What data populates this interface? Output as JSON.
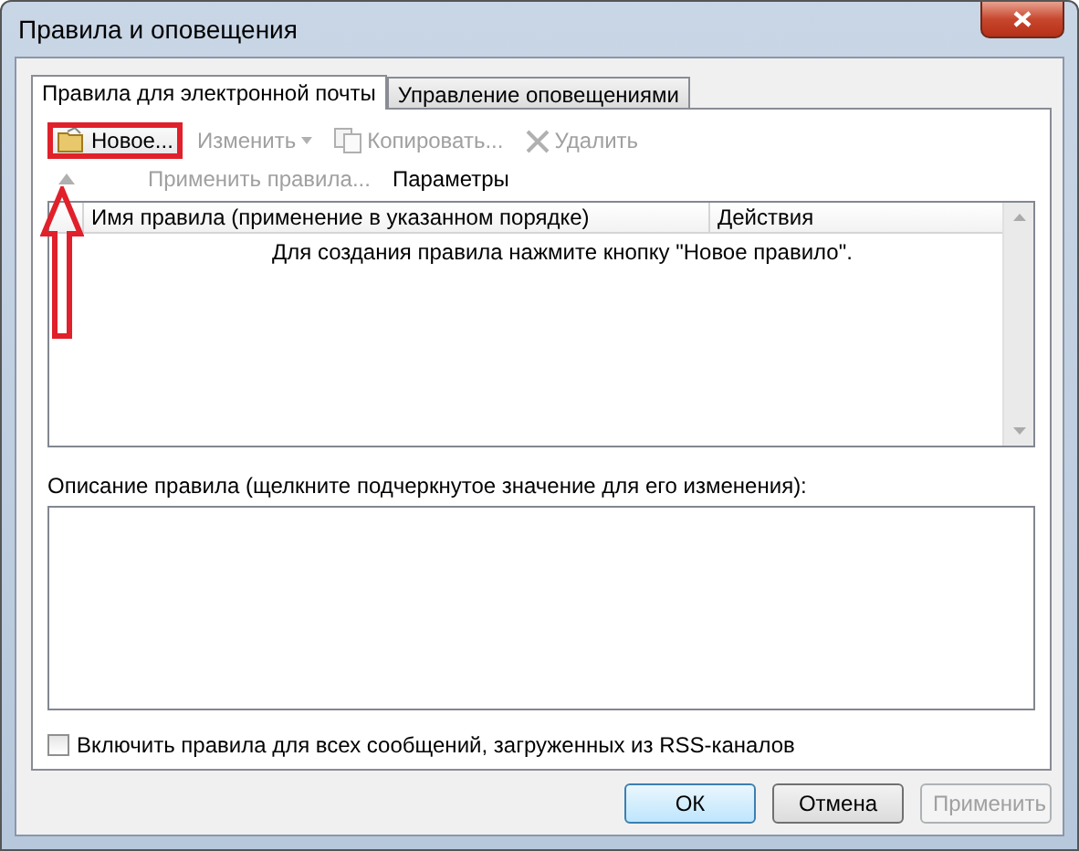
{
  "window": {
    "title": "Правила и оповещения"
  },
  "tabs": [
    {
      "label": "Правила для электронной почты",
      "selected": true
    },
    {
      "label": "Управление оповещениями",
      "selected": false
    }
  ],
  "toolbar": [
    {
      "label": "Новое...",
      "kind": "folder",
      "disabled": false
    },
    {
      "label": "Изменить",
      "kind": "dropdown",
      "disabled": true
    },
    {
      "label": "Копировать...",
      "kind": "copy",
      "disabled": true
    },
    {
      "label": "Удалить",
      "kind": "delete",
      "disabled": true
    }
  ],
  "secondary_toolbar": [
    {
      "label": "Применить правила...",
      "disabled": true
    },
    {
      "label": "Параметры",
      "disabled": false
    }
  ],
  "rules_table": {
    "columns": [
      "Имя правила (применение в указанном порядке)",
      "Действия"
    ],
    "empty_message": "Для создания правила нажмите кнопку \"Новое правило\"."
  },
  "description": {
    "label": "Описание правила (щелкните подчеркнутое значение для его изменения):"
  },
  "rss_checkbox": {
    "label": "Включить правила для всех сообщений, загруженных из RSS-каналов",
    "checked": false
  },
  "buttons": [
    {
      "label": "ОК",
      "kind": "default",
      "disabled": false
    },
    {
      "label": "Отмена",
      "kind": "normal",
      "disabled": false
    },
    {
      "label": "Применить",
      "kind": "normal",
      "disabled": true
    }
  ]
}
